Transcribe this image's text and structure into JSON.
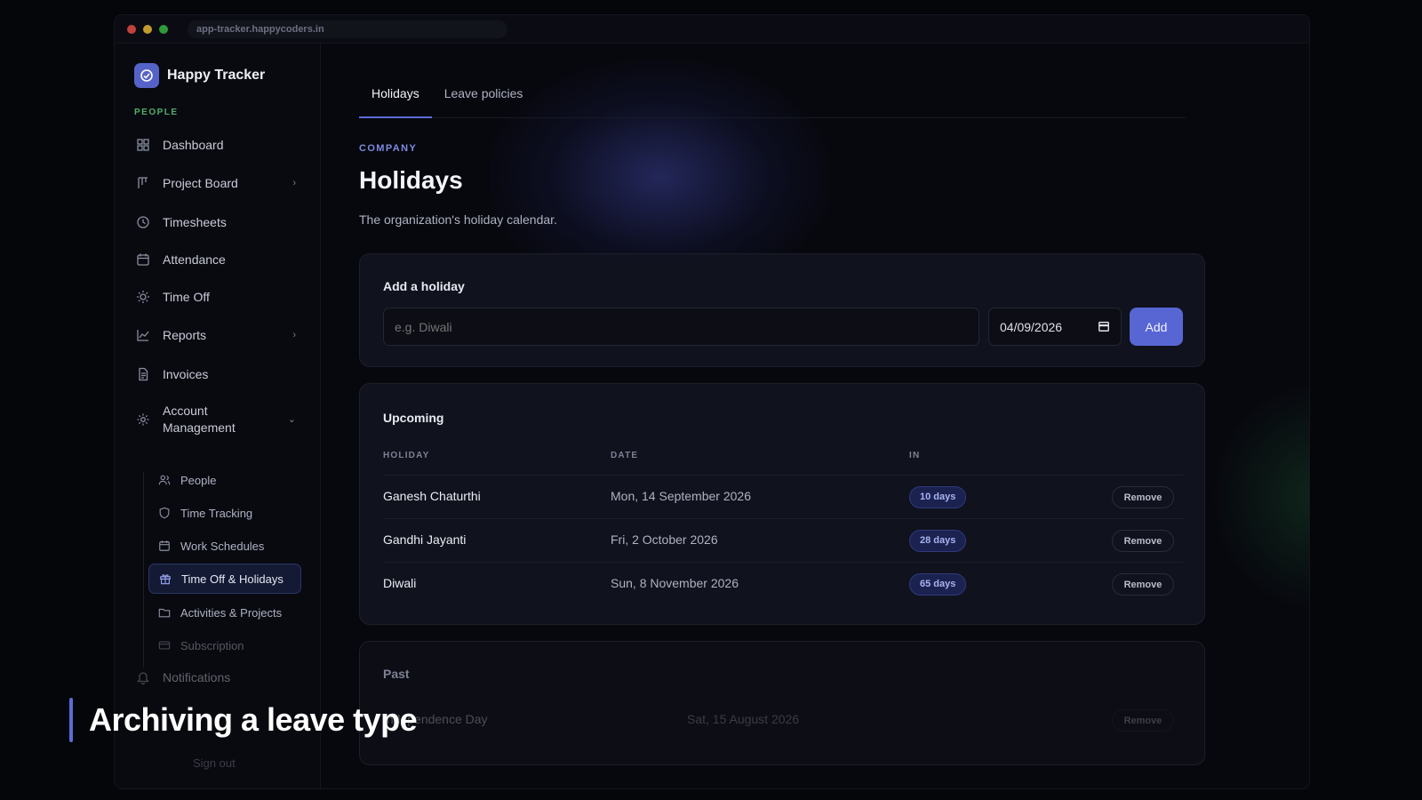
{
  "browser": {
    "url": "app-tracker.happycoders.in"
  },
  "brand": {
    "name": "Happy Tracker",
    "section": "PEOPLE"
  },
  "sidebar": {
    "items": [
      {
        "label": "Dashboard"
      },
      {
        "label": "Project Board"
      },
      {
        "label": "Timesheets"
      },
      {
        "label": "Attendance"
      },
      {
        "label": "Time Off"
      },
      {
        "label": "Reports"
      },
      {
        "label": "Invoices"
      },
      {
        "label": "Account Management"
      }
    ],
    "sub_items": [
      {
        "label": "People"
      },
      {
        "label": "Time Tracking"
      },
      {
        "label": "Work Schedules"
      },
      {
        "label": "Time Off & Holidays"
      },
      {
        "label": "Activities & Projects"
      },
      {
        "label": "Subscription"
      }
    ],
    "notifications": "Notifications",
    "sign_out": "Sign out"
  },
  "tabs": [
    {
      "label": "Holidays"
    },
    {
      "label": "Leave policies"
    }
  ],
  "page": {
    "eyebrow": "COMPANY",
    "title": "Holidays",
    "subtitle": "The organization's holiday calendar."
  },
  "add_form": {
    "title": "Add a holiday",
    "name_placeholder": "e.g. Diwali",
    "date_value": "04/09/2026",
    "add_label": "Add"
  },
  "upcoming": {
    "title": "Upcoming",
    "columns": {
      "holiday": "HOLIDAY",
      "date": "DATE",
      "in": "IN"
    },
    "rows": [
      {
        "name": "Ganesh Chaturthi",
        "date": "Mon, 14 September 2026",
        "in": "10 days",
        "action": "Remove"
      },
      {
        "name": "Gandhi Jayanti",
        "date": "Fri, 2 October 2026",
        "in": "28 days",
        "action": "Remove"
      },
      {
        "name": "Diwali",
        "date": "Sun, 8 November 2026",
        "in": "65 days",
        "action": "Remove"
      }
    ]
  },
  "past": {
    "title": "Past",
    "rows": [
      {
        "name": "Independence Day",
        "date": "Sat, 15 August 2026",
        "action": "Remove"
      }
    ]
  },
  "caption": {
    "text": "Archiving a leave type"
  },
  "colors": {
    "accent": "#5866d4",
    "brand_green": "#4fae6a",
    "background": "#07080e"
  }
}
